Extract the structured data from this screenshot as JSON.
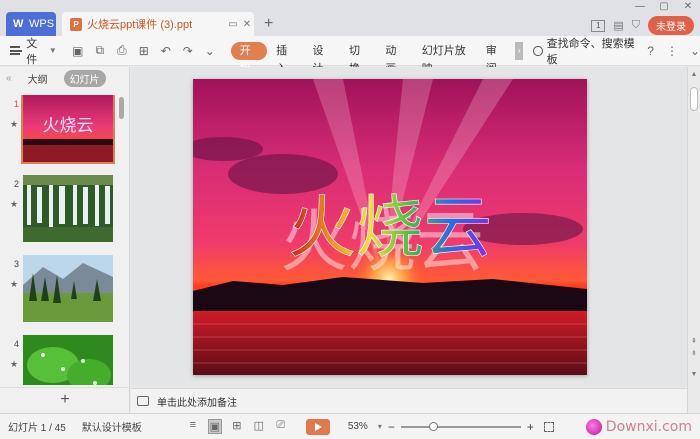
{
  "titlebar": {
    "app_tab": "WPS",
    "doc_tab": "火烧云ppt课件 (3).ppt",
    "add_tab": "+",
    "login_label": "未登录",
    "badge": "1"
  },
  "ribbon": {
    "file_menu": "文件",
    "tabs": [
      {
        "label": "开始",
        "active": true
      },
      {
        "label": "插入",
        "active": false
      },
      {
        "label": "设计",
        "active": false
      },
      {
        "label": "切换",
        "active": false
      },
      {
        "label": "动画",
        "active": false
      },
      {
        "label": "幻灯片放映",
        "active": false
      },
      {
        "label": "审阅",
        "active": false
      }
    ],
    "search_label": "查找命令、搜索模板",
    "help": "?"
  },
  "left_panel": {
    "tab_outline": "大纲",
    "tab_slides": "幻灯片",
    "thumbnails": [
      {
        "number": "1",
        "title": "火烧云",
        "selected": true
      },
      {
        "number": "2",
        "selected": false
      },
      {
        "number": "3",
        "selected": false
      },
      {
        "number": "4",
        "selected": false
      }
    ],
    "add_slide": "+"
  },
  "slide": {
    "title": "火烧云"
  },
  "notes": {
    "placeholder": "单击此处添加备注"
  },
  "status": {
    "slide_counter": "幻灯片 1 / 45",
    "template": "默认设计模板",
    "zoom": "53%",
    "zoom_fraction": 0.25,
    "zoom_minus": "−",
    "zoom_plus": "+"
  },
  "watermark": {
    "text": "Downxi.com"
  },
  "colors": {
    "wps_blue": "#4c6ed6",
    "accent_orange": "#e08050",
    "doc_title_orange": "#d9541e",
    "login_red": "#e06048"
  }
}
